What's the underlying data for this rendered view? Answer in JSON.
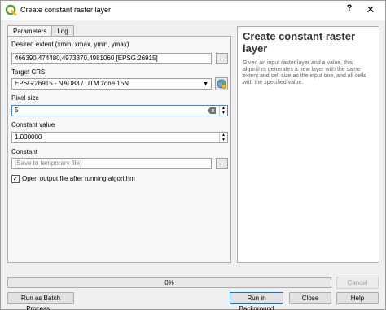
{
  "window": {
    "title": "Create constant raster layer",
    "help_glyph": "?",
    "close_glyph": "✕"
  },
  "tabs": [
    {
      "label": "Parameters"
    },
    {
      "label": "Log"
    }
  ],
  "params": {
    "extent_label": "Desired extent (xmin, xmax, ymin, ymax)",
    "extent_value": "466390,474480,4973370,4981060 [EPSG:26915]",
    "crs_label": "Target CRS",
    "crs_value": "EPSG:26915 - NAD83 / UTM zone 15N",
    "pixel_label": "Pixel size",
    "pixel_value": "5",
    "const_label": "Constant value",
    "const_value": "1.000000",
    "output_label": "Constant",
    "output_placeholder": "[Save to temporary file]",
    "open_output_label": "Open output file after running algorithm",
    "open_output_checked": "✓",
    "browse_glyph": "..."
  },
  "help": {
    "title": "Create constant raster layer",
    "body": "Given an input raster layer and a value, this algorithm generates a new layer with the same extent and cell size as the input one, and all cells with the specified value."
  },
  "progress": {
    "value": 0,
    "text": "0%"
  },
  "buttons": {
    "cancel": "Cancel",
    "batch": "Run as Batch Process...",
    "run_bg": "Run in Background",
    "close": "Close",
    "help": "Help"
  },
  "colors": {
    "accent": "#3a84d6",
    "qgis_green": "#589632"
  }
}
